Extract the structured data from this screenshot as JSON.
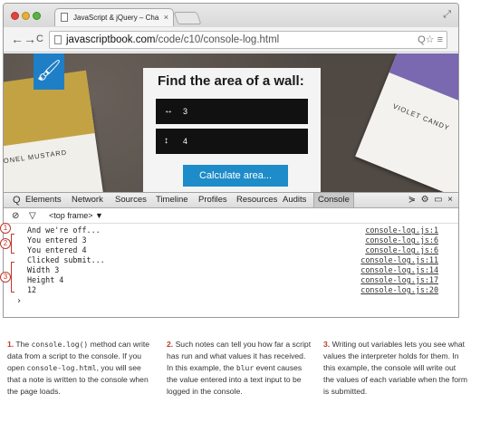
{
  "browser": {
    "tab_title": "JavaScript & jQuery – Cha",
    "tab_close": "×",
    "url_host": "javascriptbook.com",
    "url_path": "/code/c10/console-log.html",
    "back_icon": "←",
    "forward_icon": "→",
    "reload_icon": "C",
    "tools": "Q☆ ≡"
  },
  "page": {
    "heading": "Find the area of a wall:",
    "width_value": "3",
    "height_value": "4",
    "calculate_label": "Calculate area...",
    "swatch_left_label": "ONEL MUSTARD",
    "swatch_right_label": "VIOLET CANDY"
  },
  "devtools": {
    "tabs": [
      "Elements",
      "Network",
      "Sources",
      "Timeline",
      "Profiles",
      "Resources",
      "Audits",
      "Console"
    ],
    "active_tab": "Console",
    "frame_selector": "<top frame> ▼",
    "log": [
      {
        "msg": "And we're off...",
        "src": "console-log.js:1"
      },
      {
        "msg": "You entered  3",
        "src": "console-log.js:6"
      },
      {
        "msg": "You entered  4",
        "src": "console-log.js:6"
      },
      {
        "msg": "Clicked submit...",
        "src": "console-log.js:11"
      },
      {
        "msg": "Width 3",
        "src": "console-log.js:14"
      },
      {
        "msg": "Height  4",
        "src": "console-log.js:17"
      },
      {
        "msg": "12",
        "src": "console-log.js:20"
      }
    ],
    "prompt": "›"
  },
  "markers": [
    "1",
    "2",
    "3"
  ],
  "captions": [
    {
      "num": "1.",
      "parts": [
        "The ",
        "console.log()",
        " method can write data from a script to the console. If you open ",
        "console-log.html",
        ", you will see that a note is written to the console when the page loads."
      ]
    },
    {
      "num": "2.",
      "parts": [
        "Such notes can tell you how far a script has run and what values it has received. In this example, the ",
        "blur",
        " event causes the value entered into a text input to be logged in the console."
      ]
    },
    {
      "num": "3.",
      "parts": [
        "Writing out variables lets you see what values the interpreter holds for them. In this example, the console will write out the values of each variable when the form is submitted."
      ]
    }
  ]
}
